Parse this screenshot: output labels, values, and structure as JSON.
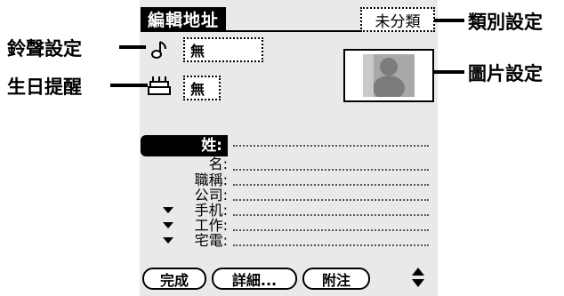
{
  "window": {
    "title": "編輯地址",
    "category": "未分類"
  },
  "fields": {
    "ringtone_value": "無",
    "birthday_value": "無",
    "last_name_label": "姓:",
    "first_name_label": "名:",
    "title_label": "職稱:",
    "company_label": "公司:",
    "mobile_label": "手机:",
    "work_label": "工作:",
    "home_label": "宅電:"
  },
  "buttons": {
    "done": "完成",
    "details": "詳細...",
    "note": "附注"
  },
  "callouts": {
    "ringtone": "鈴聲設定",
    "birthday": "生日提醒",
    "category": "類別設定",
    "picture": "圖片設定"
  },
  "colors": {
    "screen_bg": "#e9e9e9",
    "ink": "#000000"
  }
}
